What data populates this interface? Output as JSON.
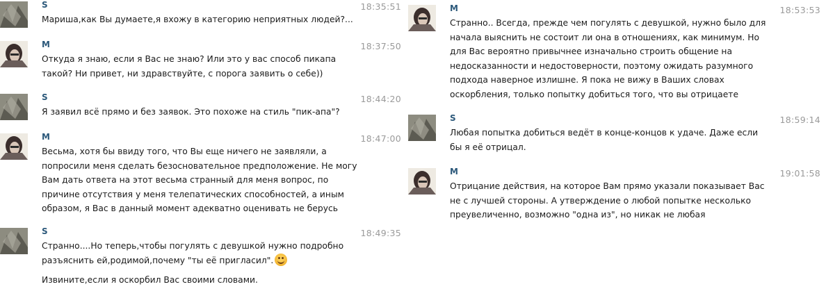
{
  "messages_left": [
    {
      "author": "S",
      "avatar": "s",
      "time": "18:35:51",
      "lines": [
        "Мариша,как Вы думаете,я вхожу в категорию неприятных людей?..."
      ]
    },
    {
      "author": "M",
      "avatar": "m",
      "time": "18:37:50",
      "lines": [
        "Откуда я знаю, если я Вас не знаю? Или это у вас способ пикапа",
        "такой? Ни привет, ни здравствуйте, с порога заявить о себе))"
      ]
    },
    {
      "author": "S",
      "avatar": "s",
      "time": "18:44:20",
      "lines": [
        "Я заявил всё прямо и без заявок. Это похоже на стиль \"пик-апа\"?"
      ]
    },
    {
      "author": "M",
      "avatar": "m",
      "time": "18:47:00",
      "lines": [
        "Весьма, хотя бы ввиду того, что Вы еще ничего не заявляли, а",
        "попросили меня сделать безосновательное предположение. Не могу",
        "Вам дать ответа на этот весьма странный для меня вопрос, по",
        "причине отсутствия у меня телепатических способностей, а иным",
        "образом, я Вас в данный момент адекватно оценивать не берусь"
      ]
    },
    {
      "author": "S",
      "avatar": "s",
      "time": "18:49:35",
      "lines": [
        "Странно....Но теперь,чтобы погулять с девушкой нужно подробно",
        "разъяснить ей,родимой,почему \"ты её пригласил\"."
      ],
      "emoji": "smile-emoji",
      "extra": "Извините,если я оскорбил Вас своими словами."
    }
  ],
  "messages_right": [
    {
      "author": "M",
      "avatar": "m",
      "time": "18:53:53",
      "lines": [
        "Странно.. Всегда, прежде чем погулять с девушкой, нужно было для",
        "начала выяснить не состоит ли она в отношениях, как минимум. Но",
        "для Вас вероятно привычнее изначально строить общение на",
        "недосказанности и недостоверности, поэтому ожидать разумного",
        "подхода наверное излишне. Я пока не вижу в Ваших словах",
        "оскорбления, только попытку добиться того, что вы отрицаете"
      ]
    },
    {
      "author": "S",
      "avatar": "s",
      "time": "18:59:14",
      "lines": [
        "Любая попытка добиться ведёт в конце-концов к удаче. Даже если",
        "бы я её отрицал."
      ]
    },
    {
      "author": "M",
      "avatar": "m",
      "time": "19:01:58",
      "lines": [
        "Отрицание действия, на которое Вам прямо указали показывает Вас",
        "не с лучшей стороны. А утверждение о любой попытке несколько",
        "преувеличенно, возможно \"одна из\", но никак не любая"
      ]
    }
  ]
}
